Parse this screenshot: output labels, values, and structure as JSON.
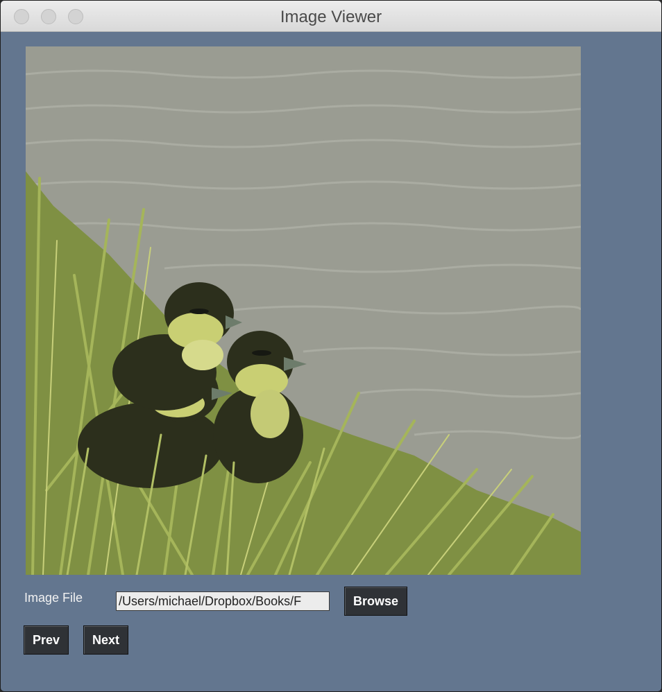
{
  "window": {
    "title": "Image Viewer"
  },
  "image_file": {
    "label": "Image File",
    "path_value": "/Users/michael/Dropbox/Books/F"
  },
  "buttons": {
    "browse": "Browse",
    "prev": "Prev",
    "next": "Next"
  },
  "colors": {
    "background": "#63768f",
    "button": "#2f3236",
    "water": "#9a9c92",
    "grass": "#8ea248",
    "duckling_body": "#2c2f1c",
    "duckling_face": "#c9cf73"
  },
  "icons": {
    "close": "traffic-light-close-icon",
    "minimize": "traffic-light-minimize-icon",
    "zoom": "traffic-light-zoom-icon"
  }
}
